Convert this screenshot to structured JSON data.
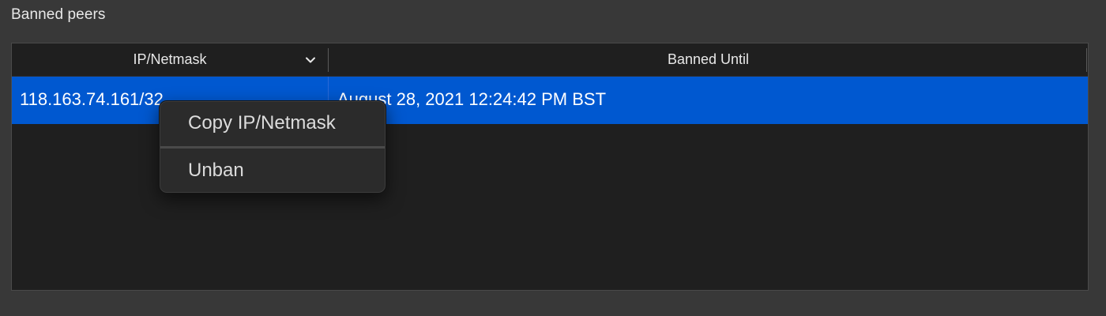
{
  "section": {
    "title": "Banned peers"
  },
  "table": {
    "columns": [
      {
        "label": "IP/Netmask",
        "sort_icon": "chevron-down-icon"
      },
      {
        "label": "Banned Until"
      }
    ],
    "rows": [
      {
        "ip": "118.163.74.161/32",
        "banned_until": "August 28, 2021 12:24:42 PM BST",
        "selected": true
      }
    ]
  },
  "context_menu": {
    "items": [
      {
        "label": "Copy IP/Netmask"
      },
      {
        "label": "Unban"
      }
    ]
  },
  "colors": {
    "window_bg": "#383838",
    "table_bg": "#1f1f1f",
    "selection": "#0058d0",
    "menu_bg": "#2b2b2b"
  }
}
